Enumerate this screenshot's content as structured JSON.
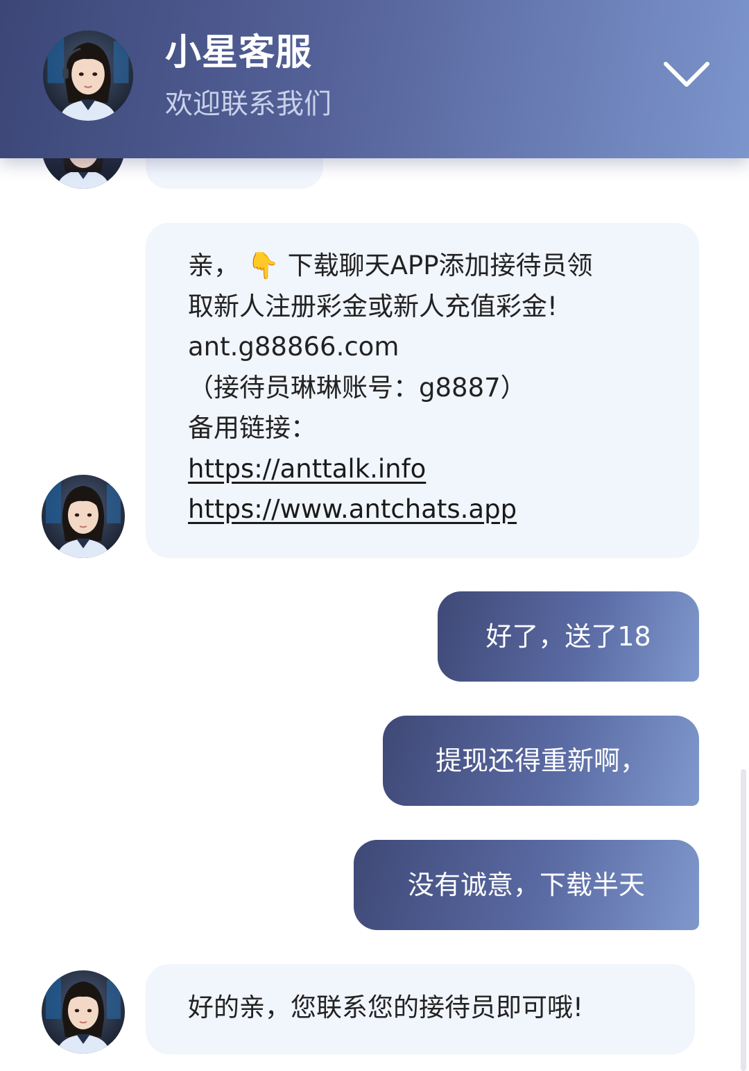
{
  "header": {
    "title": "小星客服",
    "subtitle": "欢迎联系我们",
    "collapse_icon": "chevron-down-icon"
  },
  "messages": [
    {
      "from": "agent",
      "lines": {
        "l1": "亲， 👇 下载聊天APP添加接待员领",
        "l2": "取新人注册彩金或新人充值彩金!",
        "l3": "ant.g88866.com",
        "l4": "（接待员琳琳账号：g8887）",
        "l5": "备用链接：",
        "link1": "https://anttalk.info",
        "link2": "https://www.antchats.app"
      }
    },
    {
      "from": "user",
      "text": "好了，送了18"
    },
    {
      "from": "user",
      "text": "提现还得重新啊，"
    },
    {
      "from": "user",
      "text": "没有诚意，下载半天"
    },
    {
      "from": "agent",
      "text": "好的亲，您联系您的接待员即可哦!"
    }
  ],
  "colors": {
    "header_gradient": [
      "#3c4677",
      "#7c95cc"
    ],
    "agent_bubble": "#f1f5fc",
    "user_bubble_gradient": [
      "#3f4977",
      "#7f98cc"
    ]
  }
}
